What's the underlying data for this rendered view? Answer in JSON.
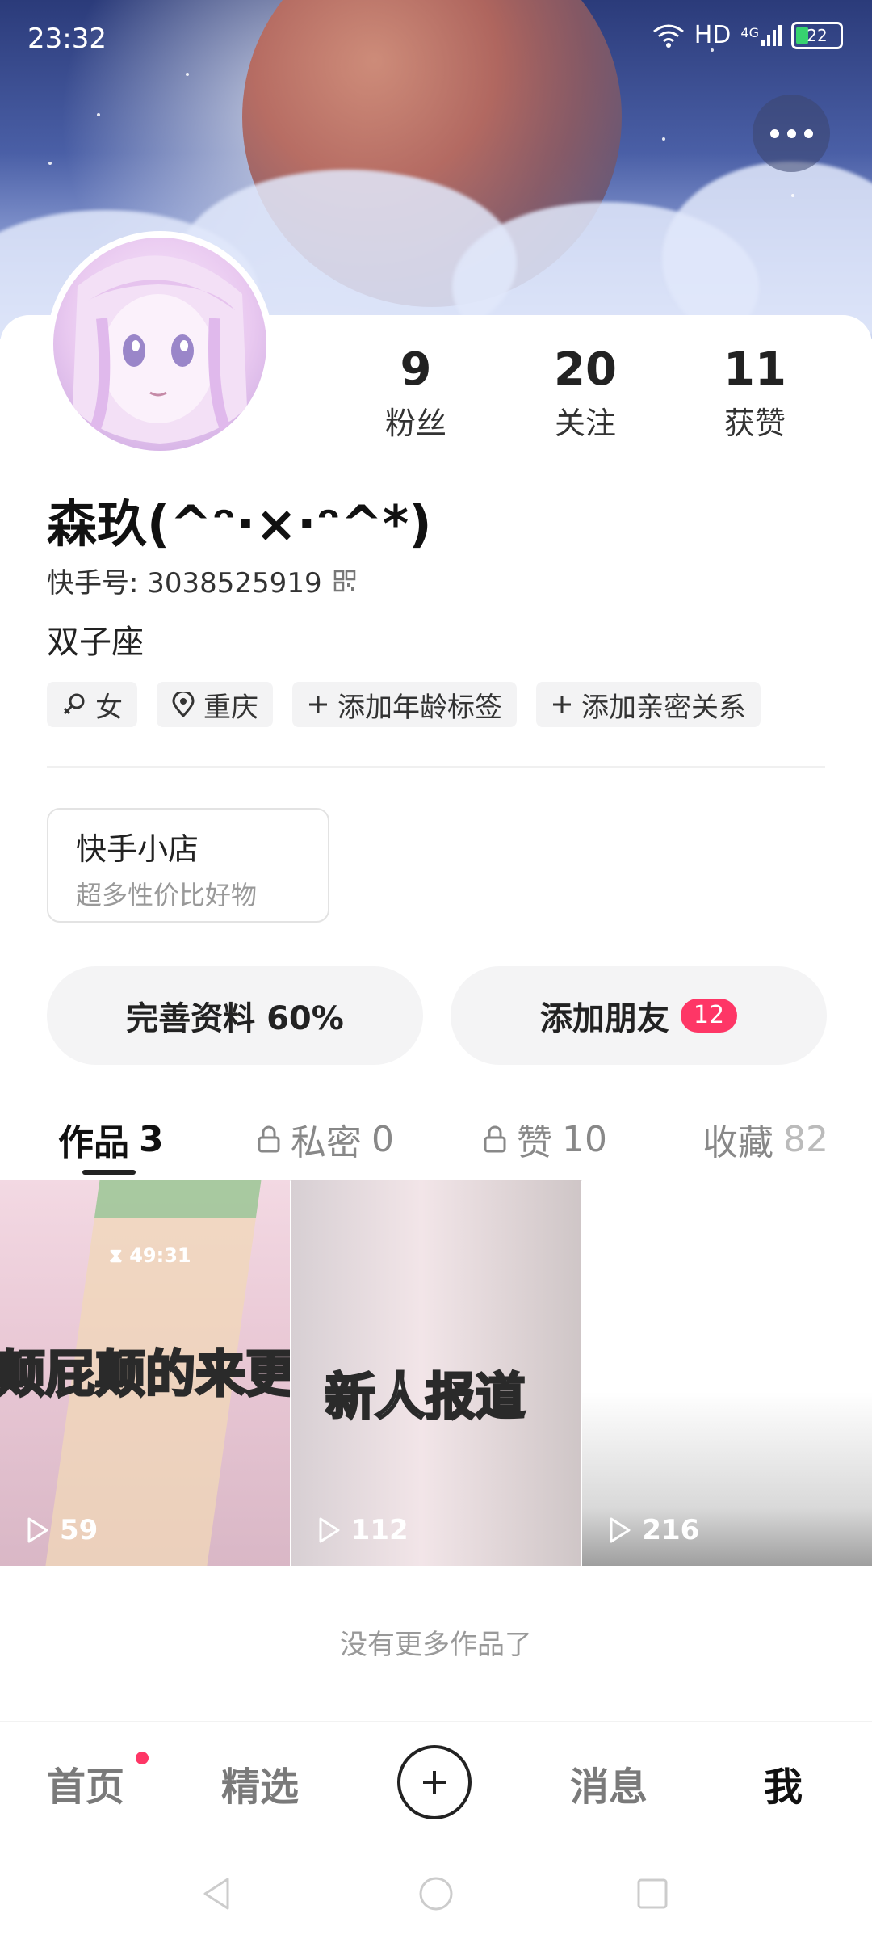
{
  "status_bar": {
    "time": "23:32",
    "network": "HD",
    "signal": "4G",
    "battery": "22"
  },
  "profile": {
    "nickname": "森玖(^ᵔ·×·ᵔ^*)",
    "kuaishou_id": "快手号: 3038525919",
    "bio": "双子座",
    "stats": [
      {
        "value": "9",
        "label": "粉丝"
      },
      {
        "value": "20",
        "label": "关注"
      },
      {
        "value": "11",
        "label": "获赞"
      }
    ],
    "tags": [
      {
        "icon": "female-icon",
        "label": "女"
      },
      {
        "icon": "location-icon",
        "label": "重庆"
      },
      {
        "icon": "plus-icon",
        "label": "添加年龄标签"
      },
      {
        "icon": "plus-icon",
        "label": "添加亲密关系"
      }
    ]
  },
  "shop": {
    "title": "快手小店",
    "subtitle": "超多性价比好物"
  },
  "actions": {
    "complete_profile": "完善资料 60%",
    "add_friends": "添加朋友",
    "add_friends_badge": "12"
  },
  "tabs": [
    {
      "label": "作品",
      "count": "3",
      "locked": false,
      "active": true
    },
    {
      "label": "私密",
      "count": "0",
      "locked": true,
      "active": false
    },
    {
      "label": "赞",
      "count": "10",
      "locked": true,
      "active": false
    },
    {
      "label": "收藏",
      "count": "82",
      "locked": false,
      "active": false
    }
  ],
  "videos": [
    {
      "plays": "59",
      "caption": "颠屁颠的来更",
      "timer": "49:31"
    },
    {
      "plays": "112",
      "caption": "新人报道"
    },
    {
      "plays": "216"
    }
  ],
  "no_more_text": "没有更多作品了",
  "bottom_nav": [
    {
      "label": "首页",
      "active": false,
      "dot": true
    },
    {
      "label": "精选",
      "active": false
    },
    {
      "label": "消息",
      "active": false
    },
    {
      "label": "我",
      "active": true
    }
  ],
  "colors": {
    "accent": "#fe3666",
    "text": "#222222",
    "muted": "#999999"
  }
}
